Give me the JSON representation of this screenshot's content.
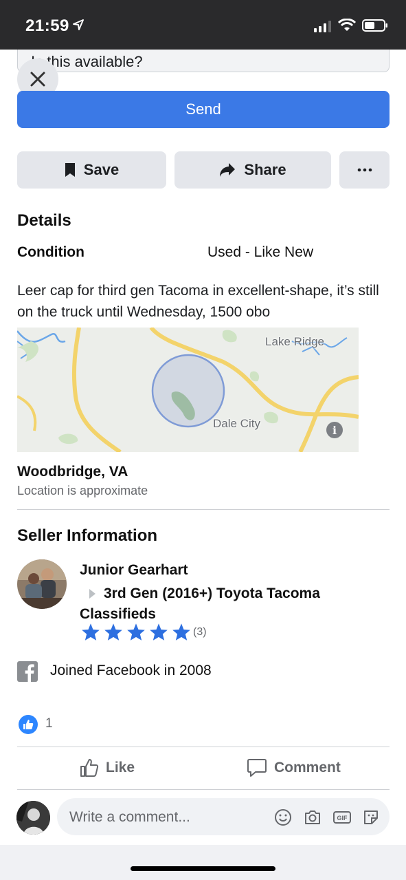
{
  "status_bar": {
    "time": "21:59"
  },
  "message": {
    "input_value": "Is this available?",
    "send_label": "Send"
  },
  "actions": {
    "save": "Save",
    "share": "Share",
    "more": "•••"
  },
  "details": {
    "title": "Details",
    "condition_label": "Condition",
    "condition_value": "Used - Like New",
    "description": "Leer cap for third gen Tacoma in excellent-shape, it’s still on the truck until Wednesday, 1500 obo"
  },
  "map": {
    "labels": [
      "Lake Ridge",
      "Dale City"
    ],
    "info": "i"
  },
  "location": {
    "city": "Woodbridge, VA",
    "note": "Location is approximate"
  },
  "seller": {
    "title": "Seller Information",
    "name": "Junior Gearhart",
    "group": "3rd Gen (2016+) Toyota Tacoma Classifieds",
    "rating_stars": 5,
    "rating_count": "(3)",
    "joined": "Joined Facebook in 2008"
  },
  "reactions": {
    "like_count": "1"
  },
  "footer": {
    "like": "Like",
    "comment": "Comment",
    "comment_placeholder": "Write a comment..."
  },
  "colors": {
    "accent": "#3b79e6",
    "star": "#2d6fe0",
    "like_badge": "#2d86ff"
  }
}
